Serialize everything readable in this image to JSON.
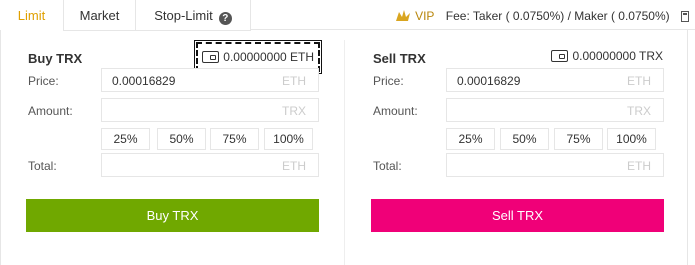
{
  "tabs": {
    "limit": "Limit",
    "market": "Market",
    "stop_limit": "Stop-Limit"
  },
  "fees": {
    "vip": "VIP",
    "text": "Fee: Taker ( 0.0750%) / Maker ( 0.0750%)"
  },
  "buy": {
    "title": "Buy TRX",
    "balance": "0.00000000 ETH",
    "price_label": "Price:",
    "price_value": "0.00016829",
    "price_unit": "ETH",
    "amount_label": "Amount:",
    "amount_unit": "TRX",
    "pct": [
      "25%",
      "50%",
      "75%",
      "100%"
    ],
    "total_label": "Total:",
    "total_unit": "ETH",
    "button": "Buy TRX"
  },
  "sell": {
    "title": "Sell TRX",
    "balance": "0.00000000 TRX",
    "price_label": "Price:",
    "price_value": "0.00016829",
    "price_unit": "ETH",
    "amount_label": "Amount:",
    "amount_unit": "TRX",
    "pct": [
      "25%",
      "50%",
      "75%",
      "100%"
    ],
    "total_label": "Total:",
    "total_unit": "ETH",
    "button": "Sell TRX"
  },
  "colors": {
    "buy": "#70a800",
    "sell": "#f00078",
    "active_tab": "#e0a000"
  },
  "icons": [
    "help-icon",
    "vip-icon",
    "calculator-icon",
    "wallet-icon"
  ]
}
